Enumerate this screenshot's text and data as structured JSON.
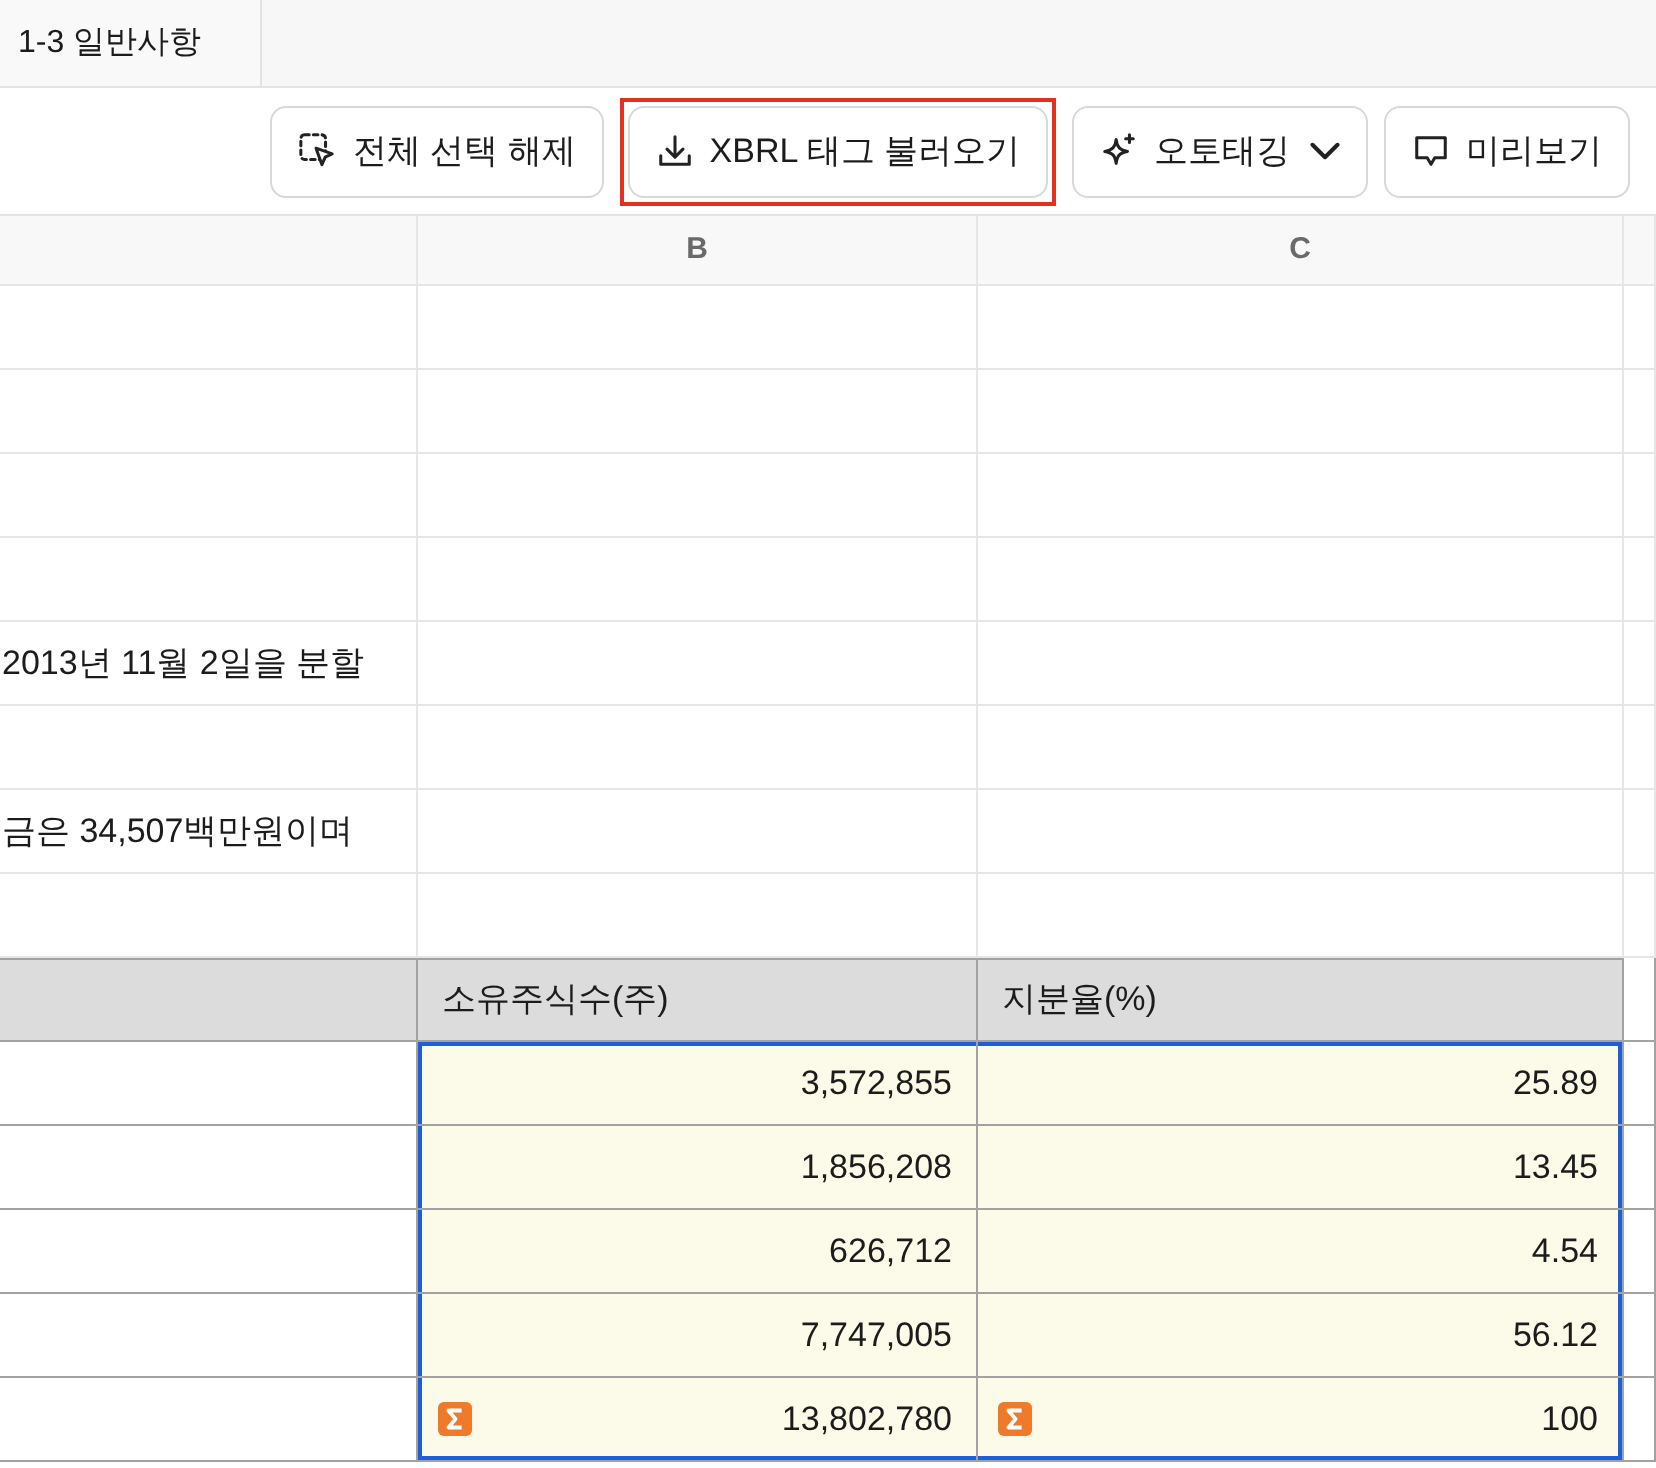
{
  "tabs": [
    {
      "label": "1-3 일반사항"
    }
  ],
  "toolbar": {
    "buttons": [
      {
        "label": "전체 선택 해제",
        "dropdown": false,
        "highlighted": false
      },
      {
        "label": "XBRL 태그 불러오기",
        "dropdown": false,
        "highlighted": true
      },
      {
        "label": "오토태깅",
        "dropdown": true,
        "highlighted": false
      },
      {
        "label": "미리보기",
        "dropdown": false,
        "highlighted": false
      }
    ]
  },
  "grid": {
    "columns": [
      {
        "label": "B"
      },
      {
        "label": "C"
      }
    ],
    "rows": [
      {
        "kind": "blank",
        "selected": false
      },
      {
        "kind": "blank",
        "selected": false
      },
      {
        "kind": "blank",
        "selected": false
      },
      {
        "kind": "blank",
        "selected": false
      },
      {
        "kind": "text",
        "column_1": "2013년 11월 2일을 분할",
        "selected": false
      },
      {
        "kind": "blank",
        "selected": false
      },
      {
        "kind": "text",
        "column_1": "금은 34,507백만원이며",
        "selected": false
      },
      {
        "kind": "blank",
        "selected": false
      },
      {
        "kind": "table_header",
        "column_2": "소유주식수(주)",
        "column_3": "지분율(%)",
        "selected": false
      },
      {
        "kind": "table_data",
        "column_2": "3,572,855",
        "column_3": "25.89",
        "selected": true
      },
      {
        "kind": "table_data",
        "column_2": "1,856,208",
        "column_3": "13.45",
        "selected": true
      },
      {
        "kind": "table_data",
        "column_2": "626,712",
        "column_3": "4.54",
        "selected": true
      },
      {
        "kind": "table_data",
        "column_2": "7,747,005",
        "column_3": "56.12",
        "selected": true
      },
      {
        "kind": "table_total",
        "column_2": "13,802,780",
        "column_3": "100",
        "selected": true
      }
    ]
  }
}
